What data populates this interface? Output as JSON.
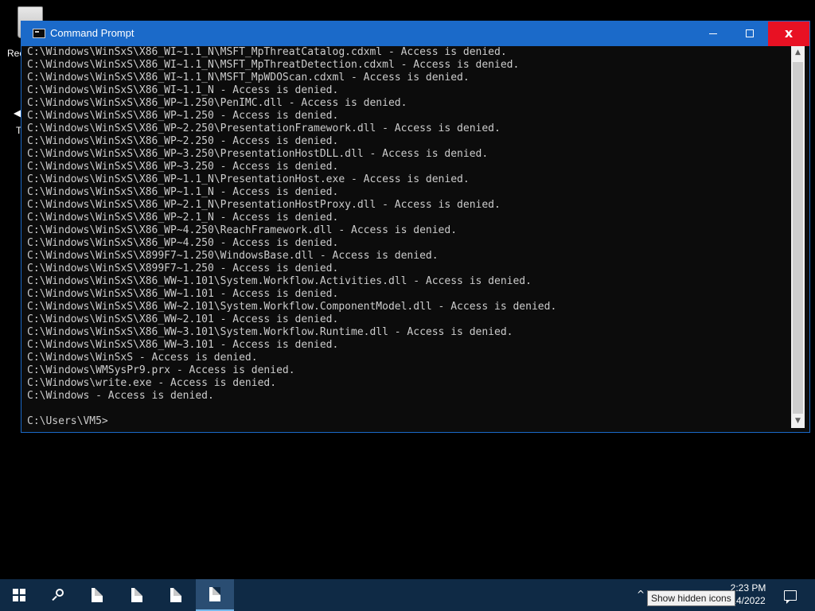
{
  "desktop": {
    "recycle_label": "Rec",
    "second_icon_label": "T"
  },
  "window": {
    "title": "Command Prompt",
    "minimize": "",
    "maximize": "",
    "close": "x"
  },
  "console": {
    "lines": [
      "C:\\Windows\\WinSxS\\X86_WI~1.1_N\\MSFT_MpThreatCatalog.cdxml - Access is denied.",
      "C:\\Windows\\WinSxS\\X86_WI~1.1_N\\MSFT_MpThreatDetection.cdxml - Access is denied.",
      "C:\\Windows\\WinSxS\\X86_WI~1.1_N\\MSFT_MpWDOScan.cdxml - Access is denied.",
      "C:\\Windows\\WinSxS\\X86_WI~1.1_N - Access is denied.",
      "C:\\Windows\\WinSxS\\X86_WP~1.250\\PenIMC.dll - Access is denied.",
      "C:\\Windows\\WinSxS\\X86_WP~1.250 - Access is denied.",
      "C:\\Windows\\WinSxS\\X86_WP~2.250\\PresentationFramework.dll - Access is denied.",
      "C:\\Windows\\WinSxS\\X86_WP~2.250 - Access is denied.",
      "C:\\Windows\\WinSxS\\X86_WP~3.250\\PresentationHostDLL.dll - Access is denied.",
      "C:\\Windows\\WinSxS\\X86_WP~3.250 - Access is denied.",
      "C:\\Windows\\WinSxS\\X86_WP~1.1_N\\PresentationHost.exe - Access is denied.",
      "C:\\Windows\\WinSxS\\X86_WP~1.1_N - Access is denied.",
      "C:\\Windows\\WinSxS\\X86_WP~2.1_N\\PresentationHostProxy.dll - Access is denied.",
      "C:\\Windows\\WinSxS\\X86_WP~2.1_N - Access is denied.",
      "C:\\Windows\\WinSxS\\X86_WP~4.250\\ReachFramework.dll - Access is denied.",
      "C:\\Windows\\WinSxS\\X86_WP~4.250 - Access is denied.",
      "C:\\Windows\\WinSxS\\X899F7~1.250\\WindowsBase.dll - Access is denied.",
      "C:\\Windows\\WinSxS\\X899F7~1.250 - Access is denied.",
      "C:\\Windows\\WinSxS\\X86_WW~1.101\\System.Workflow.Activities.dll - Access is denied.",
      "C:\\Windows\\WinSxS\\X86_WW~1.101 - Access is denied.",
      "C:\\Windows\\WinSxS\\X86_WW~2.101\\System.Workflow.ComponentModel.dll - Access is denied.",
      "C:\\Windows\\WinSxS\\X86_WW~2.101 - Access is denied.",
      "C:\\Windows\\WinSxS\\X86_WW~3.101\\System.Workflow.Runtime.dll - Access is denied.",
      "C:\\Windows\\WinSxS\\X86_WW~3.101 - Access is denied.",
      "C:\\Windows\\WinSxS - Access is denied.",
      "C:\\Windows\\WMSysPr9.prx - Access is denied.",
      "C:\\Windows\\write.exe - Access is denied.",
      "C:\\Windows - Access is denied.",
      "",
      "C:\\Users\\VM5>"
    ]
  },
  "taskbar": {
    "start_icon": "windows-logo-icon",
    "search_icon": "search-icon",
    "apps": [
      "file-icon",
      "file-icon",
      "file-icon",
      "file-icon"
    ],
    "clock_time": "2:23 PM",
    "clock_date": "14/2022",
    "tray_chevron": "^",
    "tooltip": "Show hidden icons",
    "accent_color": "#1b6ac9"
  }
}
